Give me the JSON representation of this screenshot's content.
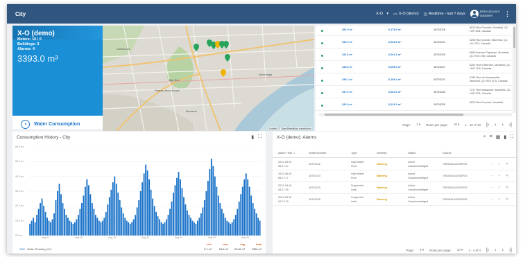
{
  "app": {
    "title": "City"
  },
  "topbar": {
    "asset": "X-O",
    "asset_caret": "▾",
    "dashboard_label": "X-O (demo)",
    "time_label": "Realtime - last 7 days",
    "user_line1": "demo account",
    "user_line2": "customer",
    "menu": "⋮"
  },
  "card": {
    "name": "X-O (demo)",
    "meters": "Meters: 10 / 0",
    "buildings": "Buildings: 3",
    "alarms": "Alarms: 4",
    "consumption": "3393.0 m³",
    "footer_label": "Water Consumption"
  },
  "map": {
    "attribution": "Leaflet | © OpenStreetMap contributors"
  },
  "meters_table": {
    "rows": [
      {
        "value1": "351.9 m³",
        "value2": "6,178.9 m³",
        "serial": "18701028",
        "address": "6020 Rue Fouchet, Montréal, QC H2P 2E8, Canada"
      },
      {
        "value1": "349.0 m³",
        "value2": "6,239.8 m³",
        "serial": "18701024",
        "address": "6296 Rue Garnier, Montréal, QC H2J 3T2, Canada"
      },
      {
        "value1": "341.6 m³",
        "value2": "6,244.1 m³",
        "serial": "18701026",
        "address": "6660 Avenue Papineau, Montréal, QC H2G 2X6, Canada"
      },
      {
        "value1": "340.8 m³",
        "value2": "6,295.6 m³",
        "serial": "18701027",
        "address": "6261 Rue D'Iberville, Montréal, QC H2G 2C6, Canada"
      },
      {
        "value1": "339.2 m³",
        "value2": "6,198.4 m³",
        "serial": "18701021",
        "address": "6784 Rue de Normanville, Montréal, QC H2S 2C9, Canada"
      },
      {
        "value1": "337.9 m³",
        "value2": "6,251.6 m³",
        "serial": "18701030",
        "address": "7217 Rue Marquette, Montréal, QC H2E 2C8, Canada"
      },
      {
        "value1": "332.8 m³",
        "value2": "6,219.3 m³",
        "serial": "18701029",
        "address": "6523 Rue Fouchet, Montréal,"
      }
    ],
    "pager": {
      "page_label": "Page:",
      "page": "1 ▾",
      "rows_label": "Rows per page:",
      "rows": "10 ▾",
      "range": "1 - 10 of 10"
    }
  },
  "history": {
    "title": "Consumption History - City",
    "legend": "Water Reading (m³)",
    "stats": {
      "h_min": "min",
      "h_max": "max",
      "h_avg": "avg",
      "h_total": "total",
      "min": "5.1 m³",
      "max": "54.8 m³",
      "avg": "20.06 m³",
      "total": "3393 m³"
    }
  },
  "chart_data": {
    "type": "bar",
    "title": "Consumption History - City",
    "series": [
      {
        "name": "Water Reading (m³)",
        "color": "#1b73c9"
      }
    ],
    "y_ticks": [
      "60.0 m³",
      "50.0 m³",
      "40.0 m³",
      "30.0 m³",
      "20.0 m³",
      "10.0 m³",
      "0.0 m³"
    ],
    "x_ticks": [
      "Aug 17",
      "Aug 18",
      "Aug 19",
      "Aug 20",
      "Aug 21",
      "Aug 22",
      "Aug 23"
    ],
    "ylim": [
      0,
      60
    ],
    "values": [
      8,
      10,
      12,
      9,
      14,
      18,
      22,
      25,
      20,
      16,
      12,
      10,
      9,
      11,
      15,
      24,
      30,
      35,
      28,
      22,
      18,
      14,
      12,
      10,
      9,
      8,
      9,
      11,
      14,
      18,
      22,
      27,
      33,
      38,
      34,
      28,
      22,
      18,
      14,
      12,
      10,
      9,
      10,
      12,
      16,
      21,
      26,
      31,
      36,
      40,
      35,
      29,
      24,
      19,
      15,
      12,
      10,
      9,
      8,
      9,
      11,
      14,
      19,
      24,
      30,
      36,
      42,
      48,
      44,
      38,
      31,
      25,
      20,
      16,
      13,
      11,
      9,
      8,
      9,
      11,
      14,
      18,
      23,
      29,
      34,
      39,
      43,
      38,
      32,
      26,
      21,
      17,
      14,
      12,
      10,
      9,
      8,
      10,
      12,
      15,
      19,
      24,
      30,
      37,
      45,
      52,
      47,
      40,
      33,
      27,
      22,
      18,
      15,
      12,
      10,
      9,
      8,
      9,
      11,
      14,
      18,
      23,
      28,
      33,
      38,
      42,
      38,
      33,
      27,
      22,
      18,
      15,
      12,
      10
    ]
  },
  "alarms": {
    "title": "X-O (demo): Alarms",
    "headers": {
      "time": "Alarm Time",
      "sort": "↓",
      "serial": "Serial Number",
      "type": "Type",
      "severity": "Severity",
      "status": "Status",
      "source": "Source"
    },
    "rows": [
      {
        "date": "2021-08-20",
        "time": "08:17:27",
        "serial": "18701022",
        "type1": "High Water",
        "type2": "Flow",
        "severity": "Warning",
        "status1": "Active",
        "status2": "Unacknowledged",
        "source": "70B3D51A40000F52"
      },
      {
        "date": "2021-08-19",
        "time": "08:17:17",
        "serial": "18701023",
        "type1": "High Water",
        "type2": "Flow",
        "severity": "Warning",
        "status1": "Active",
        "status2": "Unacknowledged",
        "source": "70B3D51A40000F53"
      },
      {
        "date": "2021-08-19",
        "time": "04:17:18",
        "serial": "18701023",
        "type1": "Suspected",
        "type2": "Leak",
        "severity": "Warning",
        "status1": "Active",
        "status2": "Unacknowledged",
        "source": "70B3D51A40000F53"
      },
      {
        "date": "2021-08-19",
        "time": "04:17:13",
        "serial": "18701025",
        "type1": "Suspected",
        "type2": "Leak",
        "severity": "Warning",
        "status1": "Active",
        "status2": "Unacknowledged",
        "source": "70B3D51A40000F55"
      }
    ],
    "pager": {
      "page_label": "Page:",
      "page": "1 ▾",
      "rows_label": "Rows per page:",
      "rows": "10 ▾",
      "range": "1 - 4 of 4"
    }
  }
}
